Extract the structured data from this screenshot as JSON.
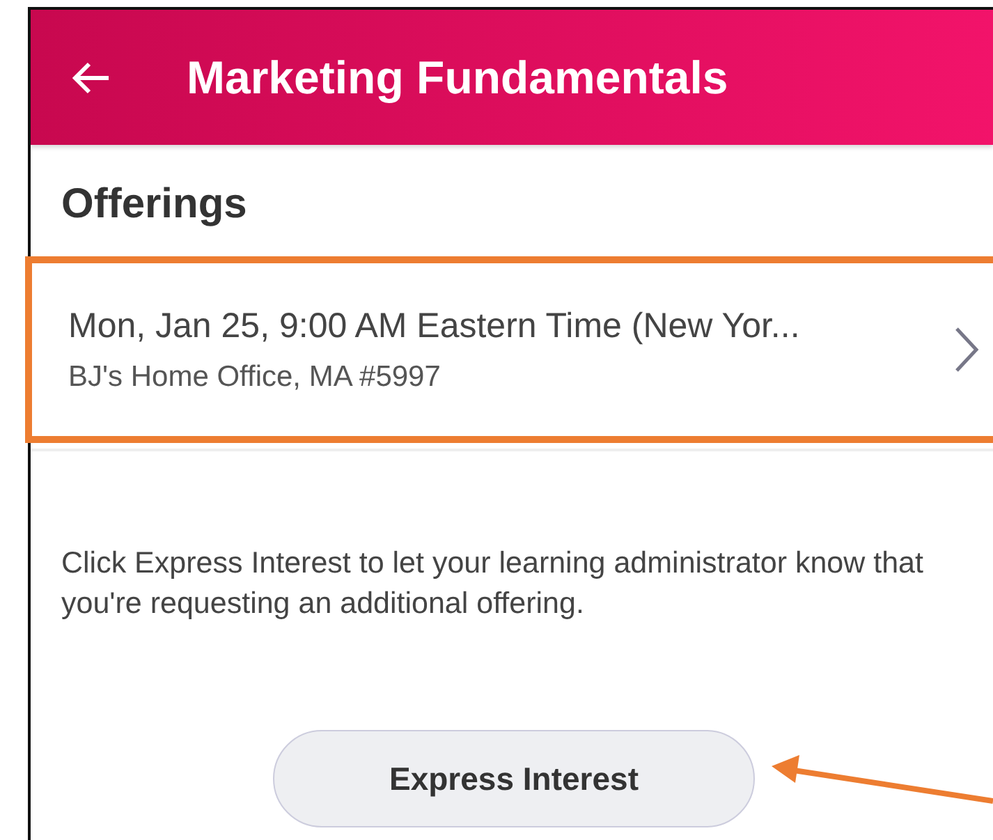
{
  "header": {
    "back_icon": true,
    "title": "Marketing Fundamentals"
  },
  "section_title": "Offerings",
  "offerings": [
    {
      "title": "Mon, Jan 25, 9:00 AM Eastern Time (New Yor...",
      "subtitle": "BJ's Home Office, MA #5997",
      "highlighted": true
    }
  ],
  "description": "Click Express Interest to let your learning administrator know that you're requesting an additional offering.",
  "button": {
    "label": "Express Interest",
    "annotated": true
  }
}
